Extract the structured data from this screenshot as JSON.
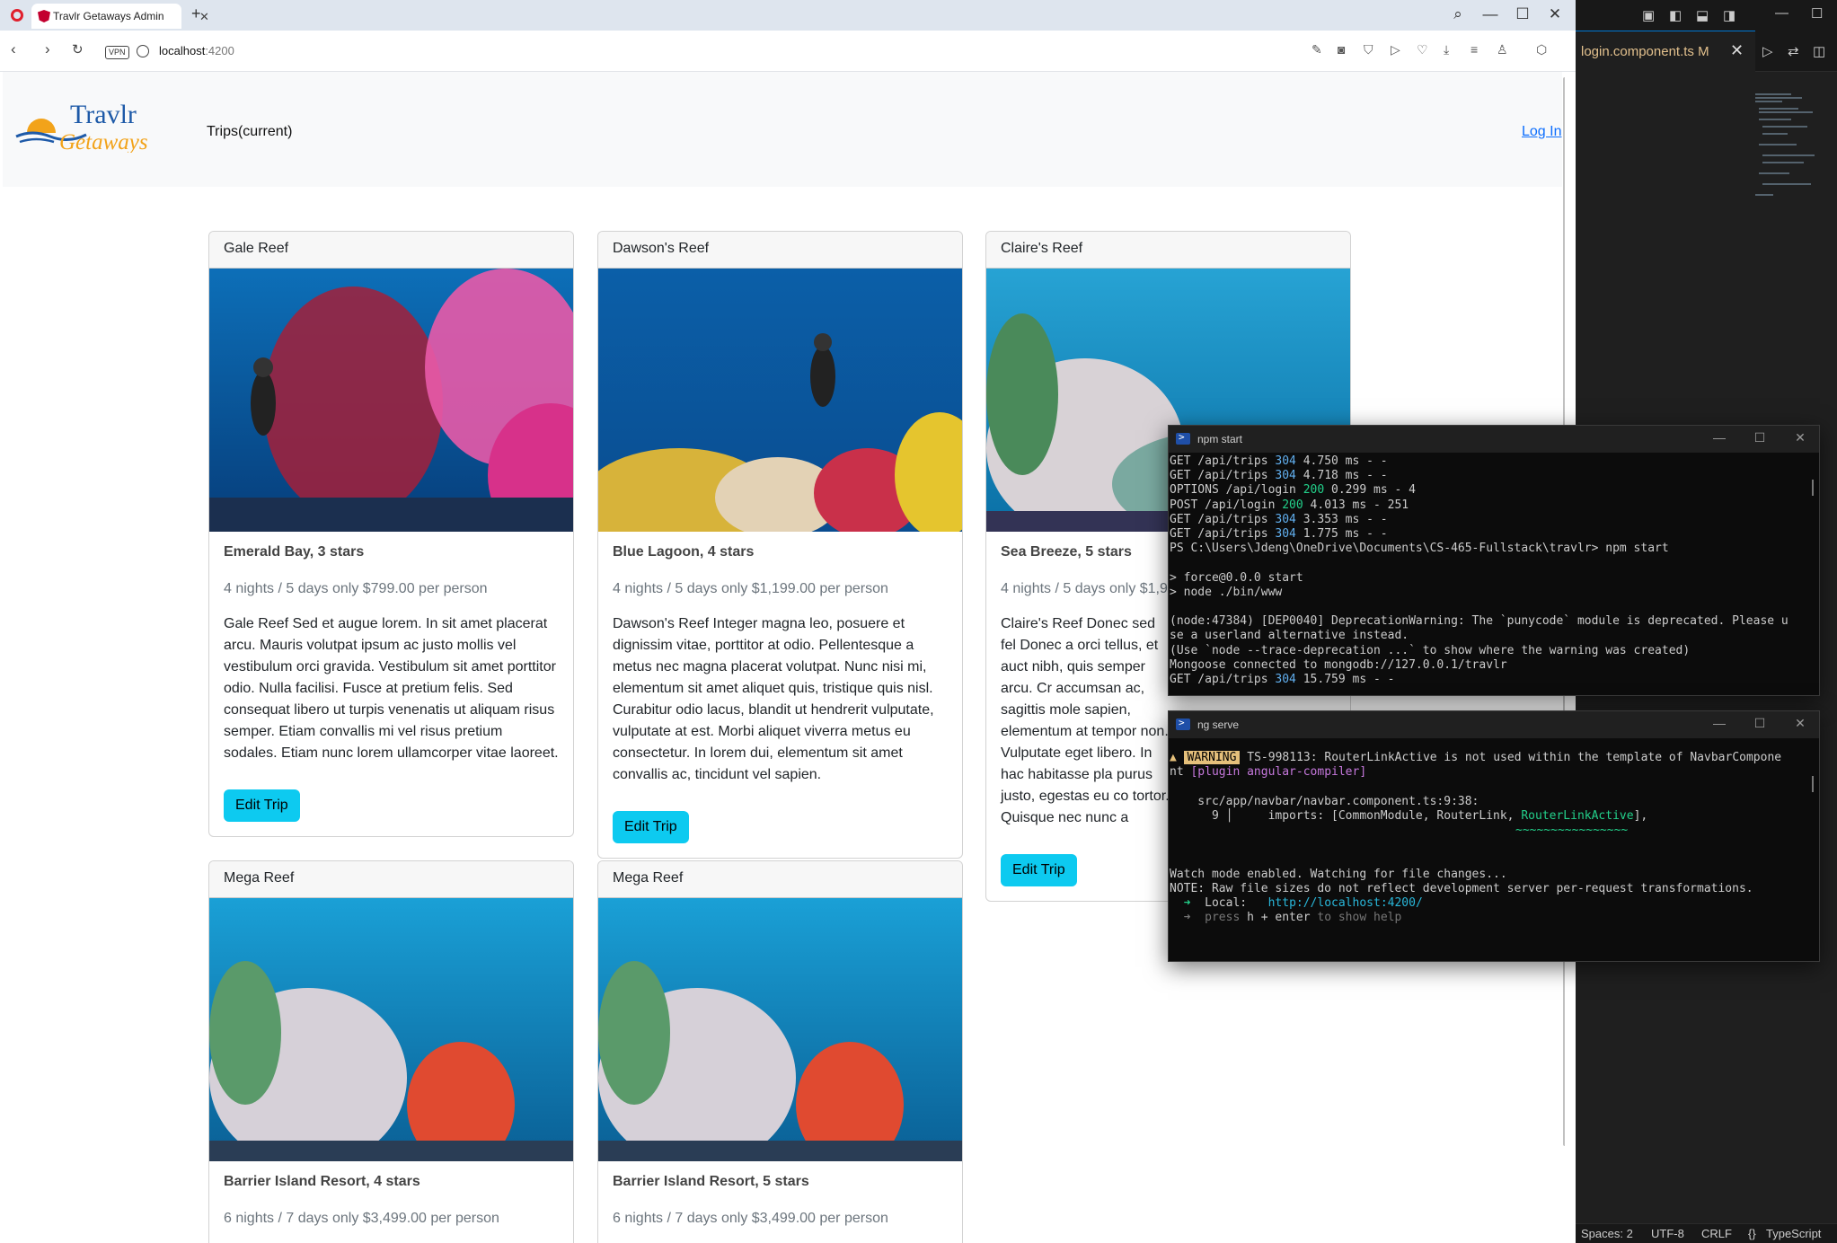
{
  "browser": {
    "tab_title": "Travlr Getaways Admin",
    "tab_close": "✕",
    "new_tab": "+",
    "url_host": "localhost",
    "url_port": ":4200",
    "vpn_label": "VPN"
  },
  "app": {
    "brand_top": "Travlr",
    "brand_bottom": "Getaways",
    "nav_trips": "Trips(current)",
    "nav_login": "Log In",
    "edit_button": "Edit Trip"
  },
  "trips": [
    {
      "name": "Gale Reef",
      "resort": "Emerald Bay, 3 stars",
      "length": "4 nights / 5 days only $799.00 per person",
      "description": "Gale Reef Sed et augue lorem. In sit amet placerat arcu. Mauris volutpat ipsum ac justo mollis vel vestibulum orci gravida. Vestibulum sit amet porttitor odio. Nulla facilisi. Fusce at pretium felis. Sed consequat libero ut turpis venenatis ut aliquam risus semper. Etiam convallis mi vel risus pretium sodales. Etiam nunc lorem ullamcorper vitae laoreet."
    },
    {
      "name": "Dawson's Reef",
      "resort": "Blue Lagoon, 4 stars",
      "length": "4 nights / 5 days only $1,199.00 per person",
      "description": "Dawson's Reef Integer magna leo, posuere et dignissim vitae, porttitor at odio. Pellentesque a metus nec magna placerat volutpat. Nunc nisi mi, elementum sit amet aliquet quis, tristique quis nisl. Curabitur odio lacus, blandit ut hendrerit vulputate, vulputate at est. Morbi aliquet viverra metus eu consectetur. In lorem dui, elementum sit amet convallis ac, tincidunt vel sapien."
    },
    {
      "name": "Claire's Reef",
      "resort": "Sea Breeze, 5 stars",
      "length": "4 nights / 5 days only $1,9",
      "description": "Claire's Reef Donec sed fel Donec a orci tellus, et auct nibh, quis semper arcu. Cr accumsan ac, sagittis mole sapien, elementum at tempor non. Vulputate eget libero. In hac habitasse pla purus justo, egestas eu co tortor. Quisque nec nunc a"
    },
    {
      "name": "Mega Reef",
      "resort": "Barrier Island Resort, 4 stars",
      "length": "6 nights / 7 days only $3,499.00 per person",
      "description": ""
    },
    {
      "name": "Mega Reef",
      "resort": "Barrier Island Resort, 5 stars",
      "length": "6 nights / 7 days only $3,499.00 per person",
      "description": ""
    }
  ],
  "terminal_npm": {
    "title": "npm start",
    "l1a": "GET /api/trips ",
    "l1b": "304",
    "l1c": " 4.750 ms - -",
    "l2a": "GET /api/trips ",
    "l2b": "304",
    "l2c": " 4.718 ms - -",
    "l3a": "OPTIONS /api/login ",
    "l3b": "200",
    "l3c": " 0.299 ms - 4",
    "l4a": "POST /api/login ",
    "l4b": "200",
    "l4c": " 4.013 ms - 251",
    "l5a": "GET /api/trips ",
    "l5b": "304",
    "l5c": " 3.353 ms - -",
    "l6a": "GET /api/trips ",
    "l6b": "304",
    "l6c": " 1.775 ms - -",
    "l7": "PS C:\\Users\\Jdeng\\OneDrive\\Documents\\CS-465-Fullstack\\travlr> npm start",
    "l8": "",
    "l9": "> force@0.0.0 start",
    "l10": "> node ./bin/www",
    "l11": "",
    "l12": "(node:47384) [DEP0040] DeprecationWarning: The `punycode` module is deprecated. Please u",
    "l13": "se a userland alternative instead.",
    "l14": "(Use `node --trace-deprecation ...` to show where the warning was created)",
    "l15": "Mongoose connected to mongodb://127.0.0.1/travlr",
    "l16a": "GET /api/trips ",
    "l16b": "304",
    "l16c": " 15.759 ms - -"
  },
  "terminal_ng": {
    "title": "ng serve",
    "warn_icon": "▲",
    "warn_badge": "WARNING",
    "warn_text": " TS-998113: RouterLinkActive is not used within the template of NavbarCompone",
    "warn_cont": "nt ",
    "plugin": "[plugin angular-compiler]",
    "file": "    src/app/navbar/navbar.component.ts:9:38:",
    "code_a": "      9 │     imports: [CommonModule, RouterLink, ",
    "code_b": "RouterLinkActive",
    "code_c": "],",
    "squiggle": "~~~~~~~~~~~~~~~~",
    "watch": "Watch mode enabled. Watching for file changes...",
    "note": "NOTE: Raw file sizes do not reflect development server per-request transformations.",
    "local_arrow": "  ➜  ",
    "local_label": "Local:   ",
    "local_url": "http://localhost:4200/",
    "help_a": "  ➜  press ",
    "help_b": "h + enter",
    "help_c": " to show help"
  },
  "vscode": {
    "tab_label": "login.component.ts",
    "tab_badge": "M",
    "status_spaces": "Spaces: 2",
    "status_encoding": "UTF-8",
    "status_eol": "CRLF",
    "status_braces": "{}",
    "status_language": "TypeScript"
  },
  "colors": {
    "accent_button": "#0dcaf0",
    "link": "#0d6efd",
    "opera_red": "#e0202d",
    "warning_badge": "#e5c07b"
  }
}
